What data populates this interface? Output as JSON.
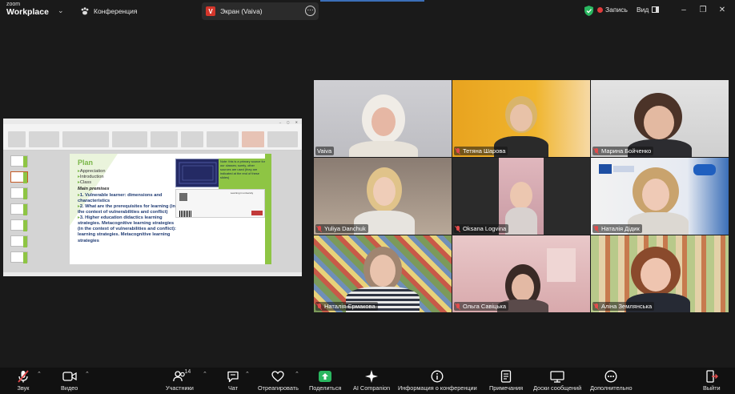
{
  "app": {
    "logo_line1": "zoom",
    "logo_line2": "Workplace",
    "meeting_tab": "Конференция",
    "share_tab_label": "Экран (Vaiva)",
    "share_tab_badge": "V",
    "recording_label": "Запись",
    "view_label": "Вид"
  },
  "shared_screen": {
    "slide_title": "Plan",
    "items": [
      "Appreciation",
      "Introduction",
      "Class"
    ],
    "premises_heading": "Main premises",
    "points": [
      "1. Vulnerable learner: dimensions and characteristics",
      "2. What are the prerequisites for learning (in the context of vulnerabilities and conflict)",
      "3. Higher education didactics learning strategies. Metacognitive learning strategies (in the context of vulnerabilities and conflict): learning strategies. Metacognitive learning strategies"
    ],
    "note_text": "Note: this is a primary source for our classes; surely, other sources are used (they are indicated at the end of these slides)",
    "info_title": "Learning in university"
  },
  "participants": [
    {
      "name": "Vaiva",
      "muted": false,
      "active": true
    },
    {
      "name": "Тетяна Шарова",
      "muted": true
    },
    {
      "name": "Марина Бойченко",
      "muted": true
    },
    {
      "name": "Yuliya Danchuk",
      "muted": true
    },
    {
      "name": "Oksana Logvina",
      "muted": true
    },
    {
      "name": "Наталія Дідик",
      "muted": true
    },
    {
      "name": "Наталія Єрмакова",
      "muted": true
    },
    {
      "name": "Ольга Савіцька",
      "muted": true
    },
    {
      "name": "Аліна Землянська",
      "muted": true
    }
  ],
  "toolbar": {
    "audio": "Звук",
    "video": "Видео",
    "participants": "Участники",
    "participants_count": "14",
    "chat": "Чат",
    "react": "Отреагировать",
    "share": "Поделиться",
    "ai": "AI Companion",
    "info": "Информация о конференции",
    "notes": "Примечания",
    "whiteboards": "Доски сообщений",
    "more": "Дополнительно",
    "leave": "Выйти"
  },
  "colors": {
    "accent_green": "#2ab760",
    "mute_red": "#e24b4b",
    "slide_green": "#8ec544",
    "active_border": "#3cc26b"
  }
}
